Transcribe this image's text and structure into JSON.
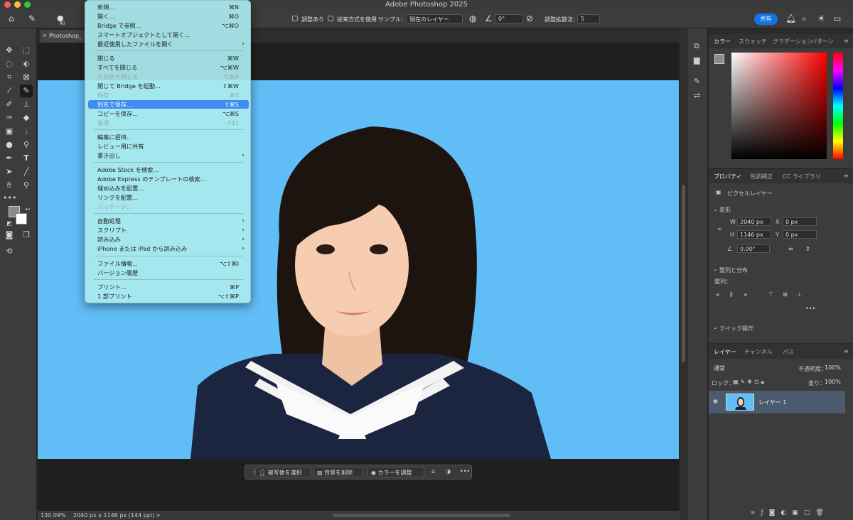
{
  "app_title": "Adobe Photoshop 2025",
  "options_bar": {
    "brush_size": "40",
    "sample_all_layers_label": "調整あり",
    "legacy_label": "従来方式を使用",
    "sample_label": "サンプル：",
    "sample_value": "現在のレイヤー",
    "angle_value": "0°",
    "diffusion_label": "調整拡散法：",
    "diffusion_value": "5",
    "share_label": "共有"
  },
  "document_tab": "Photoshop_",
  "status": {
    "zoom": "130.09%",
    "doc_info": "2040 px x 1146 px (144 ppi)",
    "more": ">"
  },
  "file_menu": {
    "items": [
      {
        "label": "新規...",
        "shortcut": "⌘N"
      },
      {
        "label": "開く...",
        "shortcut": "⌘O"
      },
      {
        "label": "Bridge で参照...",
        "shortcut": "⌥⌘O"
      },
      {
        "label": "スマートオブジェクトとして開く...",
        "shortcut": ""
      },
      {
        "label": "最近使用したファイルを開く",
        "shortcut": "",
        "submenu": true
      },
      {
        "label": "閉じる",
        "shortcut": "⌘W"
      },
      {
        "label": "すべてを閉じる",
        "shortcut": "⌥⌘W"
      },
      {
        "label": "その他を閉じる",
        "shortcut": "⌥⌘P",
        "disabled": true
      },
      {
        "label": "閉じて Bridge を起動...",
        "shortcut": "⇧⌘W"
      },
      {
        "label": "保存",
        "shortcut": "⌘S",
        "disabled": true
      },
      {
        "label": "別名で保存...",
        "shortcut": "⇧⌘S",
        "highlighted": true
      },
      {
        "label": "コピーを保存...",
        "shortcut": "⌥⌘S"
      },
      {
        "label": "復帰",
        "shortcut": "F12",
        "disabled": true
      },
      {
        "label": "編集に招待...",
        "shortcut": ""
      },
      {
        "label": "レビュー用に共有",
        "shortcut": ""
      },
      {
        "label": "書き出し",
        "shortcut": "",
        "submenu": true
      },
      {
        "label": "Adobe Stock を検索...",
        "shortcut": ""
      },
      {
        "label": "Adobe Express のテンプレートの検索...",
        "shortcut": ""
      },
      {
        "label": "埋め込みを配置...",
        "shortcut": ""
      },
      {
        "label": "リンクを配置...",
        "shortcut": ""
      },
      {
        "label": "パッケージ...",
        "shortcut": "",
        "disabled": true
      },
      {
        "label": "自動処理",
        "shortcut": "",
        "submenu": true
      },
      {
        "label": "スクリプト",
        "shortcut": "",
        "submenu": true
      },
      {
        "label": "読み込み",
        "shortcut": "",
        "submenu": true
      },
      {
        "label": "iPhone または iPad から読み込み",
        "shortcut": "",
        "submenu": true
      },
      {
        "label": "ファイル情報...",
        "shortcut": "⌥⇧⌘I"
      },
      {
        "label": "バージョン履歴",
        "shortcut": ""
      },
      {
        "label": "プリント...",
        "shortcut": "⌘P"
      },
      {
        "label": "1 部プリント",
        "shortcut": "⌥⇧⌘P"
      }
    ]
  },
  "taskbar": {
    "select_subject": "被写体を選択",
    "remove_bg": "背景を削除",
    "adjust_color": "カラーを調整",
    "more": "•••"
  },
  "color_panel": {
    "tabs": [
      "カラー",
      "スウォッチ",
      "グラデーション",
      "パターン"
    ],
    "fg_color": "#8a8a8a"
  },
  "properties_panel": {
    "tabs": [
      "プロパティ",
      "色調補正",
      "CC ライブラリ"
    ],
    "layer_kind": "ピクセルレイヤー",
    "transform_label": "変形",
    "w_label": "W",
    "w_value": "2040 px",
    "h_label": "H",
    "h_value": "1146 px",
    "x_label": "X",
    "x_value": "0 px",
    "y_label": "Y",
    "y_value": "0 px",
    "angle_value": "0.00°",
    "align_label": "整列と分布",
    "align_sub": "整列：",
    "quick_label": "クイック操作",
    "more": "•••"
  },
  "layers_panel": {
    "tabs": [
      "レイヤー",
      "チャンネル",
      "パス"
    ],
    "blend_mode": "通常",
    "opacity_label": "不透明度：",
    "opacity_value": "100%",
    "lock_label": "ロック：",
    "fill_label": "塗り：",
    "fill_value": "100%",
    "layer_name": "レイヤー 1"
  },
  "colors": {
    "canvas_bg": "#60bdf6",
    "menu_bg": "#aae9ee",
    "highlight": "#3f8bf0",
    "share_btn": "#1473e6"
  }
}
